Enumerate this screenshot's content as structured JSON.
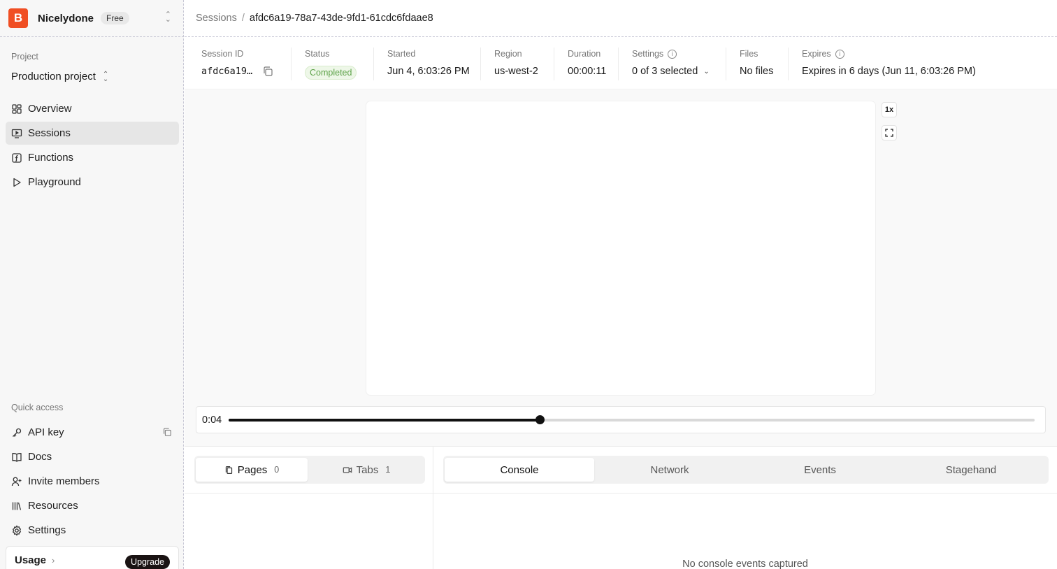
{
  "org": {
    "logo_letter": "B",
    "name": "Nicelydone",
    "plan": "Free"
  },
  "sidebar": {
    "project_label": "Project",
    "project_name": "Production project",
    "nav": [
      {
        "label": "Overview",
        "icon": "grid-icon"
      },
      {
        "label": "Sessions",
        "icon": "monitor-play-icon",
        "active": true
      },
      {
        "label": "Functions",
        "icon": "function-icon"
      },
      {
        "label": "Playground",
        "icon": "play-icon"
      }
    ],
    "quick_access_label": "Quick access",
    "quick": [
      {
        "label": "API key",
        "icon": "key-icon"
      },
      {
        "label": "Docs",
        "icon": "book-icon"
      },
      {
        "label": "Invite members",
        "icon": "user-plus-icon"
      },
      {
        "label": "Resources",
        "icon": "library-icon"
      },
      {
        "label": "Settings",
        "icon": "gear-icon"
      }
    ],
    "usage_label": "Usage",
    "upgrade_label": "Upgrade"
  },
  "breadcrumb": {
    "root": "Sessions",
    "sep": "/",
    "current": "afdc6a19-78a7-43de-9fd1-61cdc6fdaae8"
  },
  "info": {
    "session_id_label": "Session ID",
    "session_id": "afdc6a19…",
    "status_label": "Status",
    "status": "Completed",
    "started_label": "Started",
    "started": "Jun 4, 6:03:26 PM",
    "region_label": "Region",
    "region": "us-west-2",
    "duration_label": "Duration",
    "duration": "00:00:11",
    "settings_label": "Settings",
    "settings": "0 of 3 selected",
    "files_label": "Files",
    "files": "No files",
    "expires_label": "Expires",
    "expires": "Expires in 6 days (Jun 11, 6:03:26 PM)"
  },
  "player": {
    "speed": "1x",
    "time": "0:04",
    "progress": 0.386
  },
  "tabs_left": [
    {
      "label": "Pages",
      "count": "0"
    },
    {
      "label": "Tabs",
      "count": "1"
    }
  ],
  "tabs_right": [
    "Console",
    "Network",
    "Events",
    "Stagehand"
  ],
  "console_empty": "No console events captured",
  "colors": {
    "brand": "#f04e23",
    "status_green": "#5ea34a"
  }
}
